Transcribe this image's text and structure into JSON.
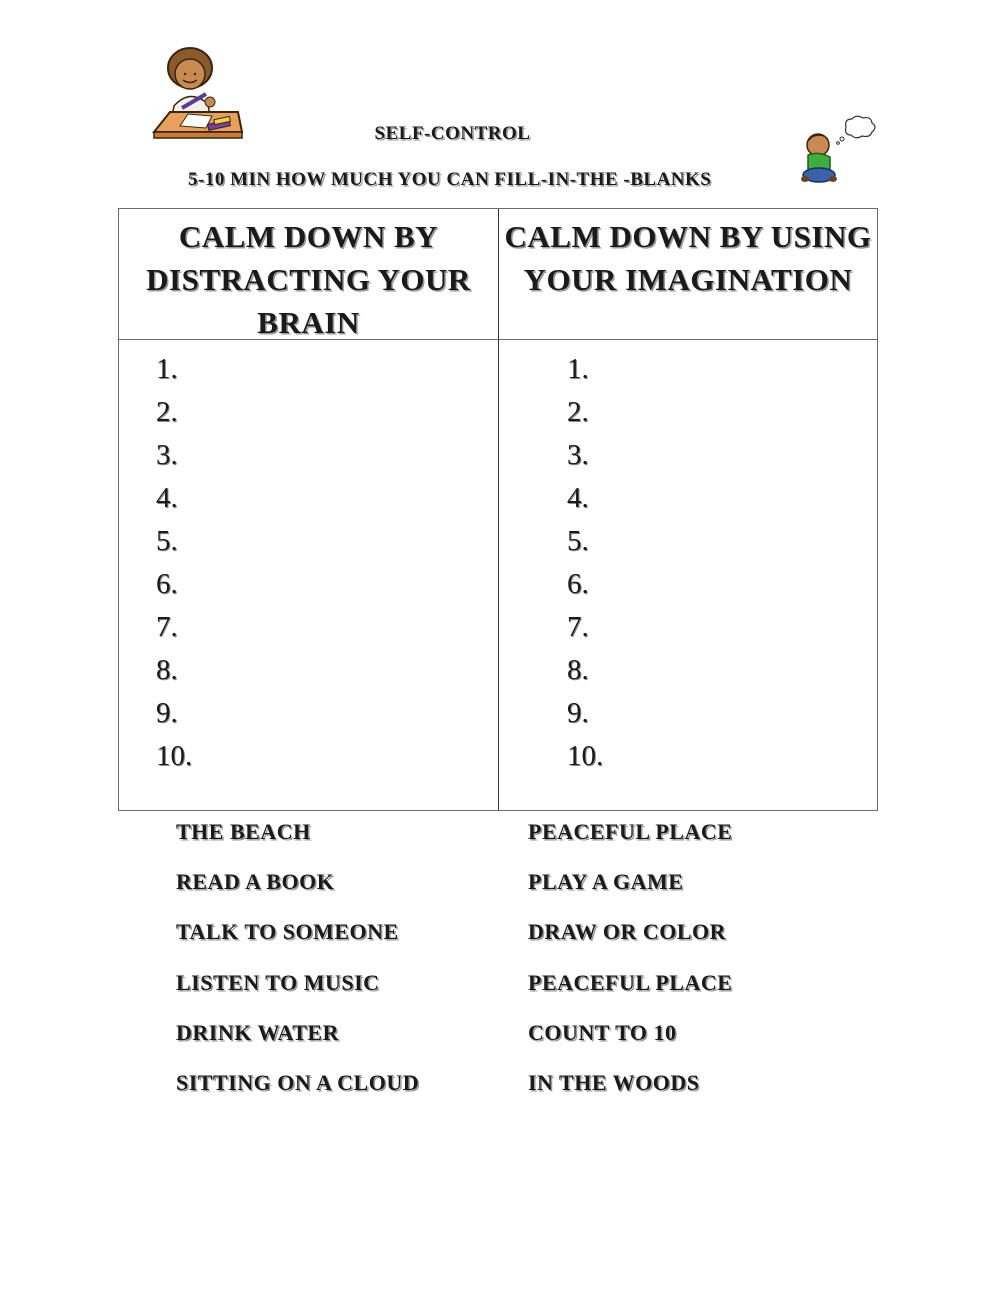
{
  "header": {
    "title": "SELF-CONTROL",
    "subtitle": "5-10 MIN HOW MUCH YOU CAN FILL-IN-THE -BLANKS",
    "left_clipart": "child-writing-at-desk-clipart",
    "right_clipart": "child-thinking-clipart"
  },
  "table": {
    "columns": [
      {
        "heading": "CALM DOWN BY DISTRACTING YOUR BRAIN"
      },
      {
        "heading": "CALM DOWN BY USING YOUR IMAGINATION"
      }
    ],
    "blank_numbers": [
      "1.",
      "2.",
      "3.",
      "4.",
      "5.",
      "6.",
      "7.",
      "8.",
      "9.",
      "10."
    ]
  },
  "word_bank": {
    "left": [
      "THE BEACH",
      "READ A BOOK",
      "TALK TO SOMEONE",
      "LISTEN TO MUSIC",
      "DRINK WATER",
      "SITTING ON A CLOUD"
    ],
    "right": [
      "PEACEFUL PLACE",
      "PLAY A GAME",
      "DRAW OR COLOR",
      "PEACEFUL PLACE",
      "COUNT TO 10",
      "IN THE WOODS"
    ]
  }
}
